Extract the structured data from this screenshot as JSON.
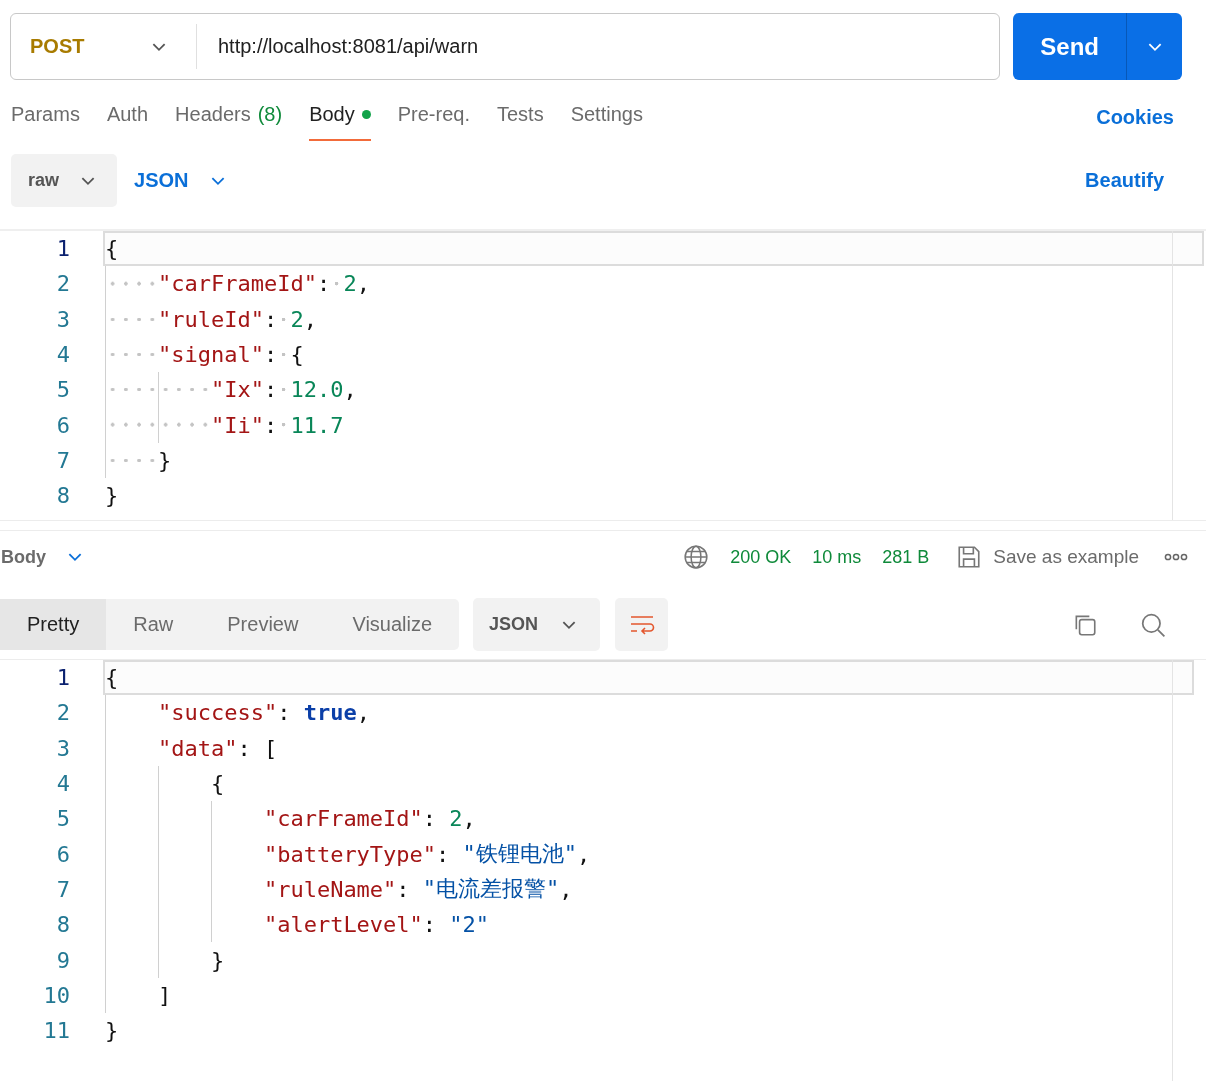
{
  "request_bar": {
    "method": "POST",
    "url": "http://localhost:8081/api/warn",
    "send_label": "Send"
  },
  "request_tabs": {
    "items": [
      {
        "label": "Params",
        "selected": false,
        "dot": false
      },
      {
        "label": "Auth",
        "selected": false,
        "dot": false
      },
      {
        "label": "Headers",
        "count": "(8)",
        "selected": false,
        "dot": false
      },
      {
        "label": "Body",
        "selected": true,
        "dot": true
      },
      {
        "label": "Pre-req.",
        "selected": false,
        "dot": false
      },
      {
        "label": "Tests",
        "selected": false,
        "dot": false
      },
      {
        "label": "Settings",
        "selected": false,
        "dot": false
      }
    ],
    "cookies_link": "Cookies"
  },
  "body_options": {
    "mode": "raw",
    "language": "JSON",
    "beautify_link": "Beautify"
  },
  "request_editor": {
    "lines": [
      {
        "number": "1",
        "current": true,
        "tokens": [
          {
            "kind": "punct",
            "text": "{"
          }
        ]
      },
      {
        "number": "2",
        "current": false,
        "tokens": [
          {
            "kind": "dotted-indent"
          },
          {
            "kind": "key",
            "text": "\"carFrameId\""
          },
          {
            "kind": "punct",
            "text": ":"
          },
          {
            "kind": "dotted-space"
          },
          {
            "kind": "number",
            "text": "2"
          },
          {
            "kind": "punct",
            "text": ","
          }
        ]
      },
      {
        "number": "3",
        "current": false,
        "tokens": [
          {
            "kind": "dotted-indent"
          },
          {
            "kind": "key",
            "text": "\"ruleId\""
          },
          {
            "kind": "punct",
            "text": ":"
          },
          {
            "kind": "dotted-space"
          },
          {
            "kind": "number",
            "text": "2"
          },
          {
            "kind": "punct",
            "text": ","
          }
        ]
      },
      {
        "number": "4",
        "current": false,
        "tokens": [
          {
            "kind": "dotted-indent"
          },
          {
            "kind": "key",
            "text": "\"signal\""
          },
          {
            "kind": "punct",
            "text": ":"
          },
          {
            "kind": "dotted-space"
          },
          {
            "kind": "punct",
            "text": "{"
          }
        ]
      },
      {
        "number": "5",
        "current": false,
        "tokens": [
          {
            "kind": "dotted-indent"
          },
          {
            "kind": "dotted-indent"
          },
          {
            "kind": "key",
            "text": "\"Ix\""
          },
          {
            "kind": "punct",
            "text": ":"
          },
          {
            "kind": "dotted-space"
          },
          {
            "kind": "number",
            "text": "12.0"
          },
          {
            "kind": "punct",
            "text": ","
          }
        ]
      },
      {
        "number": "6",
        "current": false,
        "tokens": [
          {
            "kind": "dotted-indent"
          },
          {
            "kind": "dotted-indent"
          },
          {
            "kind": "key",
            "text": "\"Ii\""
          },
          {
            "kind": "punct",
            "text": ":"
          },
          {
            "kind": "dotted-space"
          },
          {
            "kind": "number",
            "text": "11.7"
          }
        ]
      },
      {
        "number": "7",
        "current": false,
        "tokens": [
          {
            "kind": "dotted-indent"
          },
          {
            "kind": "punct",
            "text": "}"
          }
        ]
      },
      {
        "number": "8",
        "current": false,
        "tokens": [
          {
            "kind": "punct",
            "text": "}"
          }
        ]
      }
    ]
  },
  "response_bar": {
    "section": "Body",
    "status": "200 OK",
    "time": "10 ms",
    "size": "281 B",
    "save_label": "Save as example"
  },
  "response_views": {
    "items": [
      {
        "label": "Pretty",
        "selected": true
      },
      {
        "label": "Raw",
        "selected": false
      },
      {
        "label": "Preview",
        "selected": false
      },
      {
        "label": "Visualize",
        "selected": false
      }
    ],
    "language": "JSON",
    "wrap_active": true
  },
  "response_editor": {
    "lines": [
      {
        "number": "1",
        "current": true,
        "tokens": [
          {
            "kind": "punct",
            "text": "{"
          }
        ]
      },
      {
        "number": "2",
        "current": false,
        "tokens": [
          {
            "kind": "indent"
          },
          {
            "kind": "key",
            "text": "\"success\""
          },
          {
            "kind": "punct",
            "text": ":"
          },
          {
            "kind": "space"
          },
          {
            "kind": "bool",
            "text": "true"
          },
          {
            "kind": "punct",
            "text": ","
          }
        ]
      },
      {
        "number": "3",
        "current": false,
        "tokens": [
          {
            "kind": "indent"
          },
          {
            "kind": "key",
            "text": "\"data\""
          },
          {
            "kind": "punct",
            "text": ":"
          },
          {
            "kind": "space"
          },
          {
            "kind": "punct",
            "text": "["
          }
        ]
      },
      {
        "number": "4",
        "current": false,
        "tokens": [
          {
            "kind": "indent"
          },
          {
            "kind": "indent"
          },
          {
            "kind": "punct",
            "text": "{"
          }
        ]
      },
      {
        "number": "5",
        "current": false,
        "tokens": [
          {
            "kind": "indent"
          },
          {
            "kind": "indent"
          },
          {
            "kind": "indent"
          },
          {
            "kind": "key",
            "text": "\"carFrameId\""
          },
          {
            "kind": "punct",
            "text": ":"
          },
          {
            "kind": "space"
          },
          {
            "kind": "number",
            "text": "2"
          },
          {
            "kind": "punct",
            "text": ","
          }
        ]
      },
      {
        "number": "6",
        "current": false,
        "tokens": [
          {
            "kind": "indent"
          },
          {
            "kind": "indent"
          },
          {
            "kind": "indent"
          },
          {
            "kind": "key",
            "text": "\"batteryType\""
          },
          {
            "kind": "punct",
            "text": ":"
          },
          {
            "kind": "space"
          },
          {
            "kind": "string",
            "text": "\"铁锂电池\""
          },
          {
            "kind": "punct",
            "text": ","
          }
        ]
      },
      {
        "number": "7",
        "current": false,
        "tokens": [
          {
            "kind": "indent"
          },
          {
            "kind": "indent"
          },
          {
            "kind": "indent"
          },
          {
            "kind": "key",
            "text": "\"ruleName\""
          },
          {
            "kind": "punct",
            "text": ":"
          },
          {
            "kind": "space"
          },
          {
            "kind": "string",
            "text": "\"电流差报警\""
          },
          {
            "kind": "punct",
            "text": ","
          }
        ]
      },
      {
        "number": "8",
        "current": false,
        "tokens": [
          {
            "kind": "indent"
          },
          {
            "kind": "indent"
          },
          {
            "kind": "indent"
          },
          {
            "kind": "key",
            "text": "\"alertLevel\""
          },
          {
            "kind": "punct",
            "text": ":"
          },
          {
            "kind": "space"
          },
          {
            "kind": "string",
            "text": "\"2\""
          }
        ]
      },
      {
        "number": "9",
        "current": false,
        "tokens": [
          {
            "kind": "indent"
          },
          {
            "kind": "indent"
          },
          {
            "kind": "punct",
            "text": "}"
          }
        ]
      },
      {
        "number": "10",
        "current": false,
        "tokens": [
          {
            "kind": "indent"
          },
          {
            "kind": "punct",
            "text": "]"
          }
        ]
      },
      {
        "number": "11",
        "current": false,
        "tokens": [
          {
            "kind": "punct",
            "text": "}"
          }
        ]
      }
    ]
  }
}
